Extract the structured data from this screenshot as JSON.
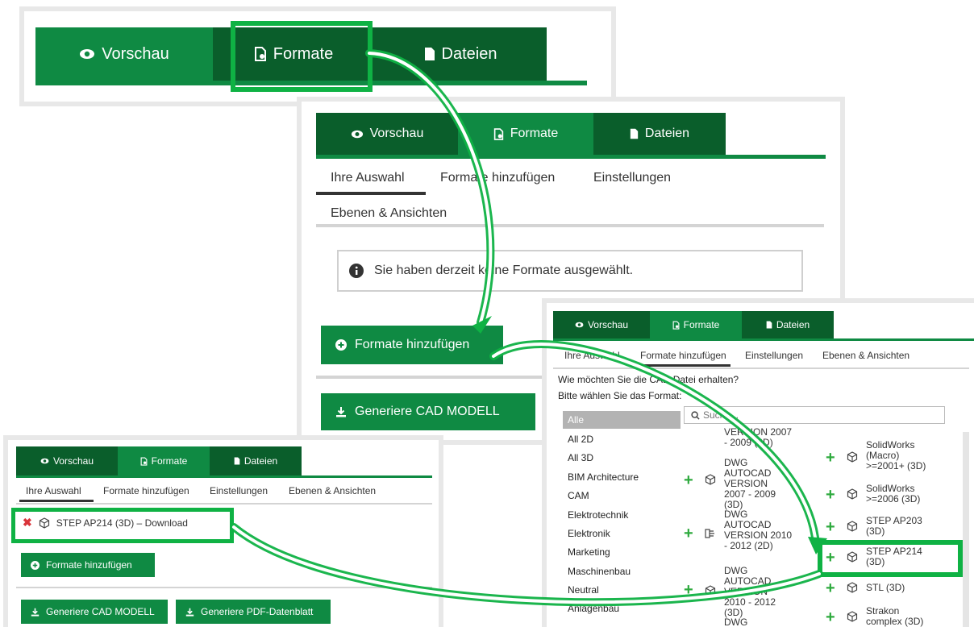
{
  "tabs": {
    "preview": "Vorschau",
    "formats": "Formate",
    "files": "Dateien"
  },
  "subtabs": {
    "selection": "Ihre Auswahl",
    "add": "Formate hinzufügen",
    "settings": "Einstellungen",
    "layers": "Ebenen & Ansichten"
  },
  "info": {
    "no_formats": "Sie haben derzeit keine Formate ausgewählt."
  },
  "buttons": {
    "add_formats": "Formate hinzufügen",
    "generate_cad": "Generiere CAD MODELL",
    "generate_pdf": "Generiere PDF-Datenblatt"
  },
  "picker": {
    "question": "Wie möchten Sie die CAD-Datei erhalten?",
    "choose": "Bitte wählen Sie das Format:",
    "search_placeholder": "Suche...",
    "categories": [
      "Alle",
      "All 2D",
      "All 3D",
      "BIM Architecture",
      "CAM",
      "Elektrotechnik",
      "Elektronik",
      "Marketing",
      "Maschinenbau",
      "Neutral",
      "Anlagenbau"
    ],
    "mid_formats": [
      "VERSION 2007 - 2009 (2D)",
      "DWG AUTOCAD VERSION 2007 - 2009 (3D)",
      "DWG AUTOCAD VERSION 2010 - 2012 (2D)",
      "DWG AUTOCAD VERSION 2010 - 2012 (3D)",
      "DWG"
    ],
    "right_formats": [
      "SolidWorks (Macro) >=2001+ (3D)",
      "SolidWorks >=2006 (3D)",
      "STEP AP203 (3D)",
      "STEP AP214 (3D)",
      "STL (3D)",
      "Strakon complex (3D)"
    ]
  },
  "selected": {
    "item": "STEP AP214 (3D) – Download"
  },
  "colors": {
    "green": "#0f8a43",
    "dark_green": "#0a5e2b",
    "highlight": "#0fb244",
    "plus": "#2eaa3e",
    "remove": "#d9343a"
  }
}
